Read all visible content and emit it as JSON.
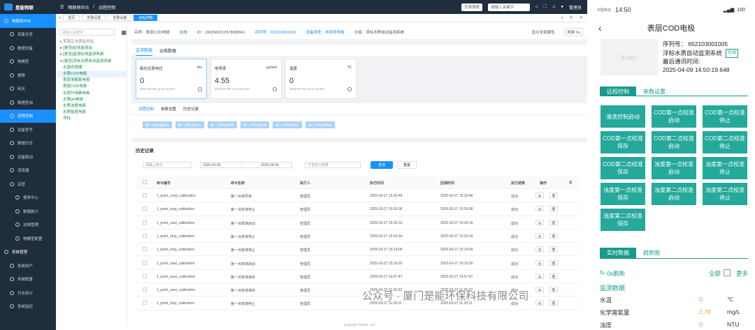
{
  "app": {
    "title": "是能物联"
  },
  "top": {
    "breadcrumb_home": "物联网中台",
    "breadcrumb_page": "远程控制",
    "search_select": "页面搜索",
    "search_placeholder": "请输入关键字",
    "user": "管理员"
  },
  "tabs": [
    {
      "label": "首页"
    },
    {
      "label": "告警设置"
    },
    {
      "label": "告警设备"
    },
    {
      "label": "远程控制"
    }
  ],
  "sidebar": {
    "group1": "物联网中台",
    "items": [
      {
        "label": "设备总览"
      },
      {
        "label": "数据设备"
      },
      {
        "label": "物模型"
      },
      {
        "label": "报警"
      },
      {
        "label": "网关"
      },
      {
        "label": "数据查询"
      },
      {
        "label": "远程控制"
      },
      {
        "label": "设备型号"
      },
      {
        "label": "数据日志"
      },
      {
        "label": "设备联动"
      },
      {
        "label": "消息器"
      },
      {
        "label": "运营"
      },
      {
        "label": "报表中心"
      },
      {
        "label": "数据统计"
      },
      {
        "label": "运维管理"
      },
      {
        "label": "物模型配置"
      }
    ],
    "group2": "系统管理",
    "items2": [
      {
        "label": "系统用户"
      },
      {
        "label": "系统配置"
      },
      {
        "label": "日志审计"
      },
      {
        "label": "系统监控"
      }
    ]
  },
  "tree": {
    "search_placeholder": "请输入关键字",
    "nodes": [
      {
        "label": "▸ 某某区水质监测站"
      },
      {
        "label": "▸ [是否]在线监测站"
      },
      {
        "label": "▸ [是否]监测在线监测系统"
      },
      {
        "label": "▾ [是否]浮标水质自动监测系统"
      },
      {
        "label": "水温传感器"
      },
      {
        "label": "水质COD电极"
      },
      {
        "label": "表层溶解氧电极"
      },
      {
        "label": "表层COD电极"
      },
      {
        "label": "水层叶绿素电极"
      },
      {
        "label": "水质pH电极"
      },
      {
        "label": "水质浊度电极"
      },
      {
        "label": "水质盐度电极"
      },
      {
        "label": "浮标"
      }
    ]
  },
  "device_header": {
    "name_label": "名称：表层COD电极",
    "status": "在线",
    "id": "ID：1902566312578088961",
    "serial": "序列号：652103001003",
    "type": "设备类型：电导率电极",
    "group": "分组：浮标水质自动监测系统",
    "show_all": "显示全部属性",
    "refresh": "刷新 0s"
  },
  "subtabs": [
    {
      "label": "监测数据"
    },
    {
      "label": "运维数据"
    }
  ],
  "metrics": [
    {
      "name": "氧化还原电位",
      "unit": "mv",
      "value": "0",
      "ts": "2025-04-09 14:42:15.407"
    },
    {
      "name": "电导率",
      "unit": "μs/cm",
      "value": "4.55",
      "ts": "2025-04-09 14:42:15.407"
    },
    {
      "name": "温度",
      "unit": "℃",
      "value": "0",
      "ts": "2025-04-09 14:42:15.407"
    }
  ],
  "control_tabs": [
    {
      "label": "远程控制"
    },
    {
      "label": "参数设置"
    },
    {
      "label": "历史记录"
    }
  ],
  "control_buttons": [
    {
      "label": "第一点校准启动"
    },
    {
      "label": "第一点校准停止"
    },
    {
      "label": "第一点校准保存"
    },
    {
      "label": "第二点校准启动"
    },
    {
      "label": "第二点校准停止"
    },
    {
      "label": "第二点校准保存"
    }
  ],
  "history": {
    "title": "历史记录",
    "filter_cmd": "请输入命令",
    "date_from": "2025-03-09",
    "date_to": "2025-04-09",
    "status_select": "下发执行结果",
    "query": "查询",
    "reset": "重置",
    "columns": [
      "命令编号",
      "命令名称",
      "执行人",
      "执行时间",
      "回调时间",
      "执行结果",
      "操作"
    ],
    "rows": [
      {
        "code": "1_point_cond_calibration",
        "name": "第一点电导率",
        "user": "管理员",
        "exec": "2025-03-27 15:30:48",
        "cb": "2025-03-27 15:30:48",
        "res": "成功"
      },
      {
        "code": "1_point_stop_calibration",
        "name": "第一点校准停止",
        "user": "管理员",
        "exec": "2025-03-27 15:30:38",
        "cb": "2025-03-27 15:30:38",
        "res": "成功"
      },
      {
        "code": "1_point_start_calibration",
        "name": "第一点校准启动",
        "user": "管理员",
        "exec": "2025-03-27 15:30:16",
        "cb": "2025-03-27 15:30:16",
        "res": "成功"
      },
      {
        "code": "1_point_stop_calibration",
        "name": "第一点校准停止",
        "user": "管理员",
        "exec": "2025-03-27 15:20:34",
        "cb": "2025-03-27 15:20:34",
        "res": "成功"
      },
      {
        "code": "1_point_stop_calibration",
        "name": "第一点校准停止",
        "user": "管理员",
        "exec": "2025-03-27 15:19:09",
        "cb": "2025-03-27 15:19:09",
        "res": "成功"
      },
      {
        "code": "1_point_start_calibration",
        "name": "第一点校准启动",
        "user": "管理员",
        "exec": "2025-03-27 15:16:20",
        "cb": "2025-03-27 15:16:20",
        "res": "成功"
      },
      {
        "code": "1_point_save_calibration",
        "name": "第一点校准保存",
        "user": "管理员",
        "exec": "2025-03-27 14:57:47",
        "cb": "2025-03-27 14:57:47",
        "res": "成功"
      },
      {
        "code": "1_point_save_calibration",
        "name": "第一点校准保存",
        "user": "管理员",
        "exec": "2025-03-27 11:26:32",
        "cb": "2025-03-27 11:26:32",
        "res": "成功"
      },
      {
        "code": "1_point_stop_calibration",
        "name": "第一点校准停止",
        "user": "管理员",
        "exec": "2025-03-27 11:26:11",
        "cb": "2025-03-27 11:26:11",
        "res": "成功"
      }
    ]
  },
  "footer": "Copyright ©2023 · AO",
  "phone": {
    "time": "14:50",
    "carrier": "中国电信",
    "battery": "100",
    "title": "表层COD电极",
    "img_text": "暂无图片",
    "serial": "序列号：  652103001005",
    "system": "浮标水质自动监测系统",
    "status": "在线",
    "last_comm_label": "最后通讯时间:",
    "last_comm": "2025-04-09 14:50:19.648",
    "tabs": [
      {
        "label": "远程控制"
      },
      {
        "label": "参数设置"
      }
    ],
    "buttons": [
      {
        "label": "清洗控制启动"
      },
      {
        "label": "COD第一点校准启动"
      },
      {
        "label": "COD第一点校准停止"
      },
      {
        "label": "COD第一点校准保存"
      },
      {
        "label": "COD第二点校准启动"
      },
      {
        "label": "COD第二点校准停止"
      },
      {
        "label": "COD第二点校准保存"
      },
      {
        "label": "浊度第一点校准启动"
      },
      {
        "label": "浊度第一点校准停止"
      },
      {
        "label": "浊度第一点校准保存"
      },
      {
        "label": "浊度第二点校准启动"
      },
      {
        "label": "浊度第二点校准停止"
      },
      {
        "label": "浊度第二点校准保存"
      }
    ],
    "tabs2": [
      {
        "label": "实时数据"
      },
      {
        "label": "趋势图"
      }
    ],
    "refresh": "0s刷新",
    "all": "全部",
    "more": "更多",
    "section": "监测数据",
    "rows": [
      {
        "name": "水温",
        "value": "0",
        "unit": "℃"
      },
      {
        "name": "化学需氧量",
        "value": "2.78",
        "unit": "mg/L"
      },
      {
        "name": "浊度",
        "value": "0",
        "unit": "NTU"
      }
    ]
  },
  "watermark": "公众号 · 厦门是能环保科技有限公司"
}
